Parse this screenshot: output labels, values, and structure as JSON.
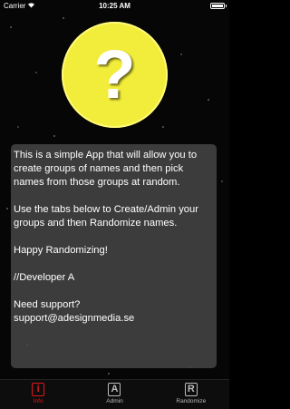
{
  "status_bar": {
    "carrier": "Carrier",
    "time": "10:25 AM"
  },
  "logo": {
    "glyph": "?"
  },
  "info": {
    "paragraphs": [
      "This is a simple App that will allow you to create groups of names and then pick names from those groups at random.",
      "Use the tabs below to Create/Admin your groups and then Randomize names.",
      "Happy Randomizing!",
      "//Developer A",
      "Need support?\nsupport@adesignmedia.se"
    ]
  },
  "tabs": [
    {
      "icon": "i",
      "label": "Info",
      "active": true
    },
    {
      "icon": "A",
      "label": "Admin",
      "active": false
    },
    {
      "icon": "R",
      "label": "Randomize",
      "active": false
    }
  ],
  "colors": {
    "accent": "#e0161b",
    "logo_yellow": "#f2ec3a",
    "card_bg": "#484848"
  }
}
